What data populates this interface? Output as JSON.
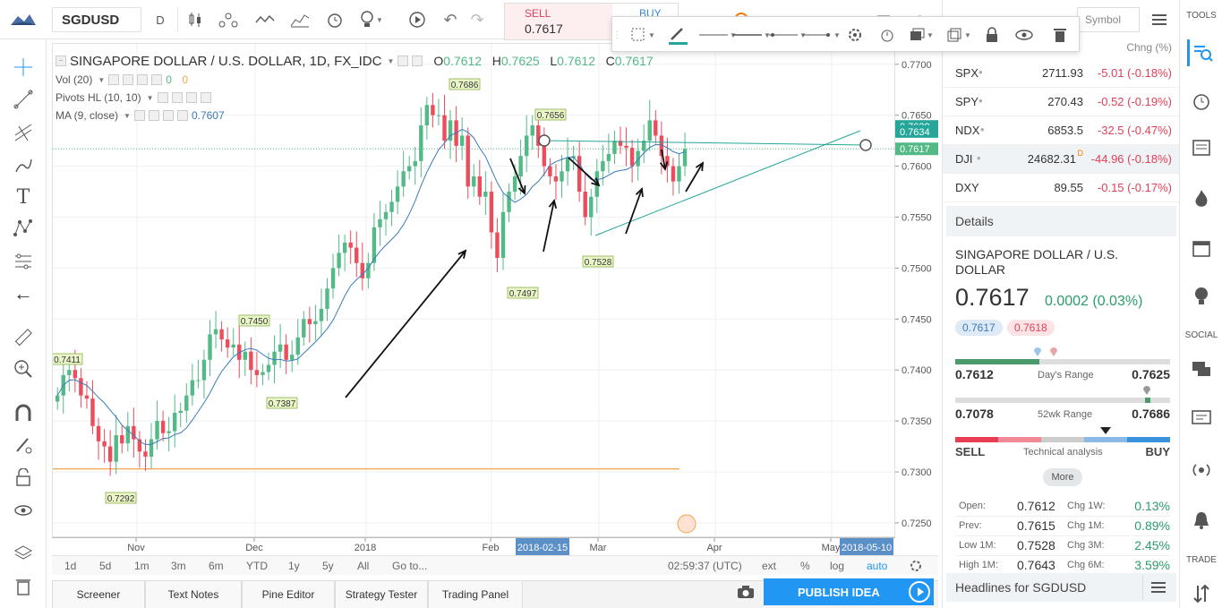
{
  "header": {
    "symbol": "SGDUSD",
    "interval": "D",
    "sell": {
      "label": "SELL",
      "value": "0.7617"
    },
    "buy": {
      "label": "BUY"
    }
  },
  "legend": {
    "title": "SINGAPORE DOLLAR / U.S. DOLLAR, 1D, FX_IDC",
    "open_label": "O",
    "open": "0.7612",
    "high_label": "H",
    "high": "0.7625",
    "low_label": "L",
    "low": "0.7612",
    "close_label": "C",
    "close": "0.7617",
    "vol": "Vol (20)",
    "vol_v1": "0",
    "vol_v2": "0",
    "pivots": "Pivots HL (10, 10)",
    "ma": "MA (9, close)",
    "ma_value": "0.7607"
  },
  "chart_data": {
    "type": "candlestick",
    "symbol": "SINGAPORE DOLLAR / U.S. DOLLAR, 1D, FX_IDC",
    "x_ticks": [
      "Nov",
      "Dec",
      "2018",
      "Feb",
      "Mar",
      "Apr",
      "May"
    ],
    "y_ticks": [
      "0.7700",
      "0.7650",
      "0.7600",
      "0.7550",
      "0.7500",
      "0.7450",
      "0.7400",
      "0.7350",
      "0.7300",
      "0.7250"
    ],
    "ylim": [
      0.7235,
      0.772
    ],
    "price_labels": [
      {
        "value": "0.7639",
        "color": "#26a69a"
      },
      {
        "value": "0.7634",
        "color": "#26a69a"
      },
      {
        "value": "0.7617",
        "color": "#53b987"
      }
    ],
    "cursor_time_labels": [
      "2018-02-15",
      "2018-05-10"
    ],
    "pivots": [
      "0.7411",
      "0.7450",
      "0.7387",
      "0.7292",
      "0.7686",
      "0.7656",
      "0.7497",
      "0.7528"
    ],
    "closes": [
      0.7375,
      0.7395,
      0.74,
      0.7392,
      0.7375,
      0.7372,
      0.7345,
      0.733,
      0.7325,
      0.731,
      0.7336,
      0.7328,
      0.7345,
      0.7332,
      0.732,
      0.7315,
      0.7332,
      0.735,
      0.7338,
      0.734,
      0.7358,
      0.736,
      0.7375,
      0.739,
      0.739,
      0.741,
      0.7435,
      0.744,
      0.743,
      0.7422,
      0.7425,
      0.741,
      0.7418,
      0.74,
      0.7395,
      0.7398,
      0.7405,
      0.7418,
      0.7425,
      0.741,
      0.7415,
      0.7432,
      0.745,
      0.7445,
      0.7448,
      0.746,
      0.748,
      0.75,
      0.7515,
      0.7525,
      0.752,
      0.7505,
      0.749,
      0.7505,
      0.754,
      0.7548,
      0.7555,
      0.7565,
      0.758,
      0.7595,
      0.76,
      0.7605,
      0.764,
      0.766,
      0.765,
      0.765,
      0.7625,
      0.7645,
      0.762,
      0.763,
      0.758,
      0.759,
      0.757,
      0.7575,
      0.7535,
      0.751,
      0.7555,
      0.7575,
      0.759,
      0.761,
      0.763,
      0.764,
      0.762,
      0.76,
      0.759,
      0.7585,
      0.7595,
      0.7608,
      0.761,
      0.7575,
      0.755,
      0.757,
      0.7595,
      0.7605,
      0.7612,
      0.7625,
      0.762,
      0.7618,
      0.76,
      0.7615,
      0.7625,
      0.7645,
      0.763,
      0.761,
      0.76,
      0.7585,
      0.76,
      0.7617
    ],
    "series": [
      {
        "name": "MA (9, close)",
        "last": "0.7607"
      }
    ]
  },
  "bottom_bar": {
    "ranges": [
      "1d",
      "5d",
      "1m",
      "3m",
      "6m",
      "YTD",
      "1y",
      "5y",
      "All"
    ],
    "goto": "Go to...",
    "time": "02:59:37 (UTC)",
    "opts": [
      "ext",
      "%",
      "log",
      "auto"
    ]
  },
  "panels": [
    "Screener",
    "Text Notes",
    "Pine Editor",
    "Strategy Tester",
    "Trading Panel"
  ],
  "publish": "PUBLISH IDEA",
  "watchlist": {
    "search_placeholder": "Symbol",
    "chng_header": "Chng (%)",
    "rows": [
      {
        "sym": "SPX",
        "last": "2711.93",
        "chg": "-5.01 (-0.18%)"
      },
      {
        "sym": "SPY",
        "last": "270.43",
        "chg": "-0.52 (-0.19%)"
      },
      {
        "sym": "NDX",
        "last": "6853.5",
        "chg": "-32.5 (-0.47%)"
      },
      {
        "sym": "DJI",
        "last": "24682.31",
        "mark": "D",
        "chg": "-44.96 (-0.18%)"
      },
      {
        "sym": "DXY",
        "last": "89.55",
        "chg": "-0.15 (-0.17%)"
      }
    ]
  },
  "details": {
    "header": "Details",
    "name": "SINGAPORE DOLLAR / U.S. DOLLAR",
    "price": "0.7617",
    "change": "0.0002 (0.03%)",
    "bid": "0.7617",
    "ask": "0.7618",
    "days_low": "0.7612",
    "days_label": "Day's Range",
    "days_high": "0.7625",
    "wk_low": "0.7078",
    "wk_label": "52wk Range",
    "wk_high": "0.7686",
    "sell": "SELL",
    "ta_label": "Technical analysis",
    "buy": "BUY",
    "more": "More",
    "stats": [
      {
        "k": "Open:",
        "v": "0.7612",
        "k2": "Chg 1W:",
        "v2": "0.13%"
      },
      {
        "k": "Prev:",
        "v": "0.7615",
        "k2": "Chg 1M:",
        "v2": "0.89%"
      },
      {
        "k": "Low 1M:",
        "v": "0.7528",
        "k2": "Chg 3M:",
        "v2": "2.45%"
      },
      {
        "k": "High 1M:",
        "v": "0.7643",
        "k2": "Chg 6M:",
        "v2": "3.59%"
      }
    ],
    "headlines": "Headlines for SGDUSD"
  },
  "sidebar": {
    "tools": "TOOLS",
    "social": "SOCIAL",
    "trade": "TRADE"
  }
}
